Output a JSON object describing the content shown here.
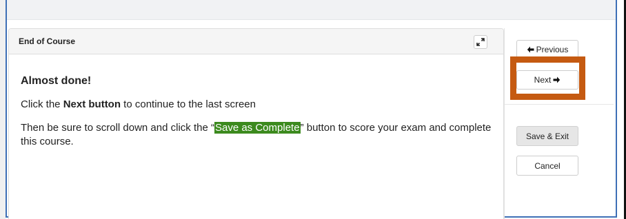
{
  "panel": {
    "title": "End of Course",
    "expand_icon": "expand-arrows-icon"
  },
  "content": {
    "headline": "Almost done!",
    "line1_prefix": "Click the ",
    "line1_bold": "Next button",
    "line1_suffix": " to continue to the last screen",
    "line2_prefix": "Then be sure to scroll down and click the “",
    "line2_highlight": "Save as Complete",
    "line2_suffix": "” button to score your exam and complete this course."
  },
  "navigation": {
    "previous_label": "Previous",
    "previous_icon": "arrow-left-icon",
    "next_label": "Next",
    "next_icon": "arrow-right-icon"
  },
  "actions": {
    "save_exit_label": "Save & Exit",
    "cancel_label": "Cancel"
  },
  "colors": {
    "frame_border": "#3d6fb6",
    "highlight_bg": "#3c8a1e",
    "annotation_box": "#c55a11"
  }
}
